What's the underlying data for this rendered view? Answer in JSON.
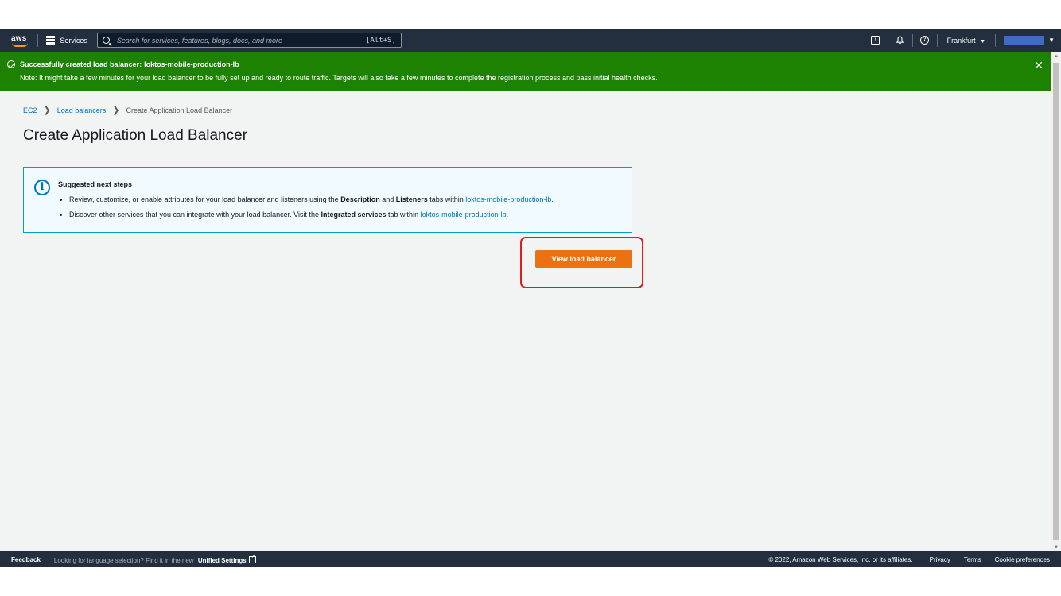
{
  "nav": {
    "logo_text": "aws",
    "services_label": "Services",
    "search_placeholder": "Search for services, features, blogs, docs, and more",
    "search_shortcut": "[Alt+S]",
    "region": "Frankfurt",
    "region_caret": "▼",
    "account_caret": "▼"
  },
  "flash": {
    "title": "Successfully created load balancer:",
    "lb_name": "loktos-mobile-production-lb",
    "note": "Note: It might take a few minutes for your load balancer to be fully set up and ready to route traffic. Targets will also take a few minutes to complete the registration process and pass initial health checks.",
    "close": "✕"
  },
  "breadcrumb": {
    "items": [
      "EC2",
      "Load balancers",
      "Create Application Load Balancer"
    ],
    "separator": "❯"
  },
  "page": {
    "title": "Create Application Load Balancer"
  },
  "info": {
    "icon": "i",
    "title": "Suggested next steps",
    "item1": {
      "prefix": "Review, customize, or enable attributes for your load balancer and listeners using the ",
      "bold1": "Description",
      "middle": " and ",
      "bold2": "Listeners",
      "suffix": " tabs within ",
      "link": "loktos-mobile-production-lb",
      "end": "."
    },
    "item2": {
      "prefix": "Discover other services that you can integrate with your load balancer. Visit the ",
      "bold": "Integrated services",
      "suffix": " tab within ",
      "link": "loktos-mobile-production-lb",
      "end": "."
    }
  },
  "actions": {
    "view_button": "View load balancer"
  },
  "footer": {
    "feedback": "Feedback",
    "language_note": "Looking for language selection? Find it in the new",
    "unified_settings": "Unified Settings",
    "copyright": "© 2022, Amazon Web Services, Inc. or its affiliates.",
    "privacy": "Privacy",
    "terms": "Terms",
    "cookies": "Cookie preferences"
  },
  "colors": {
    "nav_bg": "#232f3e",
    "flash_success": "#1d8102",
    "primary_button": "#ec7211",
    "link": "#0073bb",
    "highlight_ring": "#e31b1b"
  }
}
